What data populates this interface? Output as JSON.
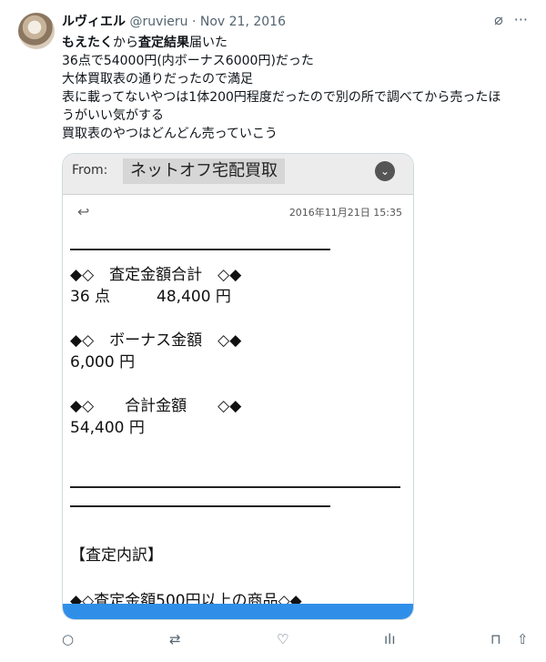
{
  "user": {
    "display_name": "ルヴィエル",
    "handle": "@ruvieru",
    "separator": "·",
    "date": "Nov 21, 2016"
  },
  "tweet_lines": [
    [
      "もえたく",
      "から",
      "査定結果",
      "届いた"
    ],
    "36点で54000円(内ボーナス6000円)だった",
    "大体買取表の通りだったので満足",
    "表に載ってないやつは1体200円程度だったので別の所で調べてから売ったほ",
    "うがいい気がする",
    "買取表のやつはどんどん売っていこう"
  ],
  "email": {
    "from_label": "From:",
    "sender": "ネットオフ宅配買取",
    "datetime": "2016年11月21日 15:35",
    "total_heading": "◆◇　査定金額合計　◇◆",
    "total_value": "36 点　　　48,400 円",
    "bonus_heading": "◆◇　ボーナス金額　◇◆",
    "bonus_value": "6,000 円",
    "sum_heading": "◆◇　　合計金額　　◇◆",
    "sum_value": "54,400 円",
    "breakdown_heading": "【査定内訳】",
    "item_heading": "◆◇査定金額500円以上の商品◇◆"
  },
  "icons": {
    "no_notify": "slash-circle-icon",
    "more": "more-icon",
    "reply": "reply-icon",
    "retweet": "retweet-icon",
    "like": "heart-icon",
    "views": "views-icon",
    "bookmark": "bookmark-icon",
    "share": "share-icon"
  }
}
